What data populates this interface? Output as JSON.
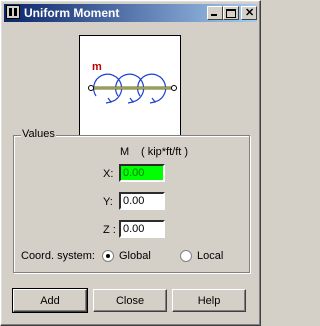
{
  "window": {
    "title": "Uniform Moment"
  },
  "diagram": {
    "label": "m"
  },
  "values_group": {
    "label": "Values",
    "column_header": "M",
    "units": "( kip*ft/ft )",
    "x_label": "X:",
    "x_value": "0.00",
    "y_label": "Y:",
    "y_value": "0.00",
    "z_label": "Z :",
    "z_value": "0.00",
    "coord_label": "Coord. system:",
    "options": [
      {
        "label": "Global",
        "selected": true
      },
      {
        "label": "Local",
        "selected": false
      }
    ]
  },
  "buttons": {
    "add": "Add",
    "close": "Close",
    "help": "Help"
  },
  "colors": {
    "active_field_bg": "#00ff00",
    "title_bar": "#0a246a",
    "moment_arrows": "#1f3fd0",
    "label_m": "#c00000"
  }
}
